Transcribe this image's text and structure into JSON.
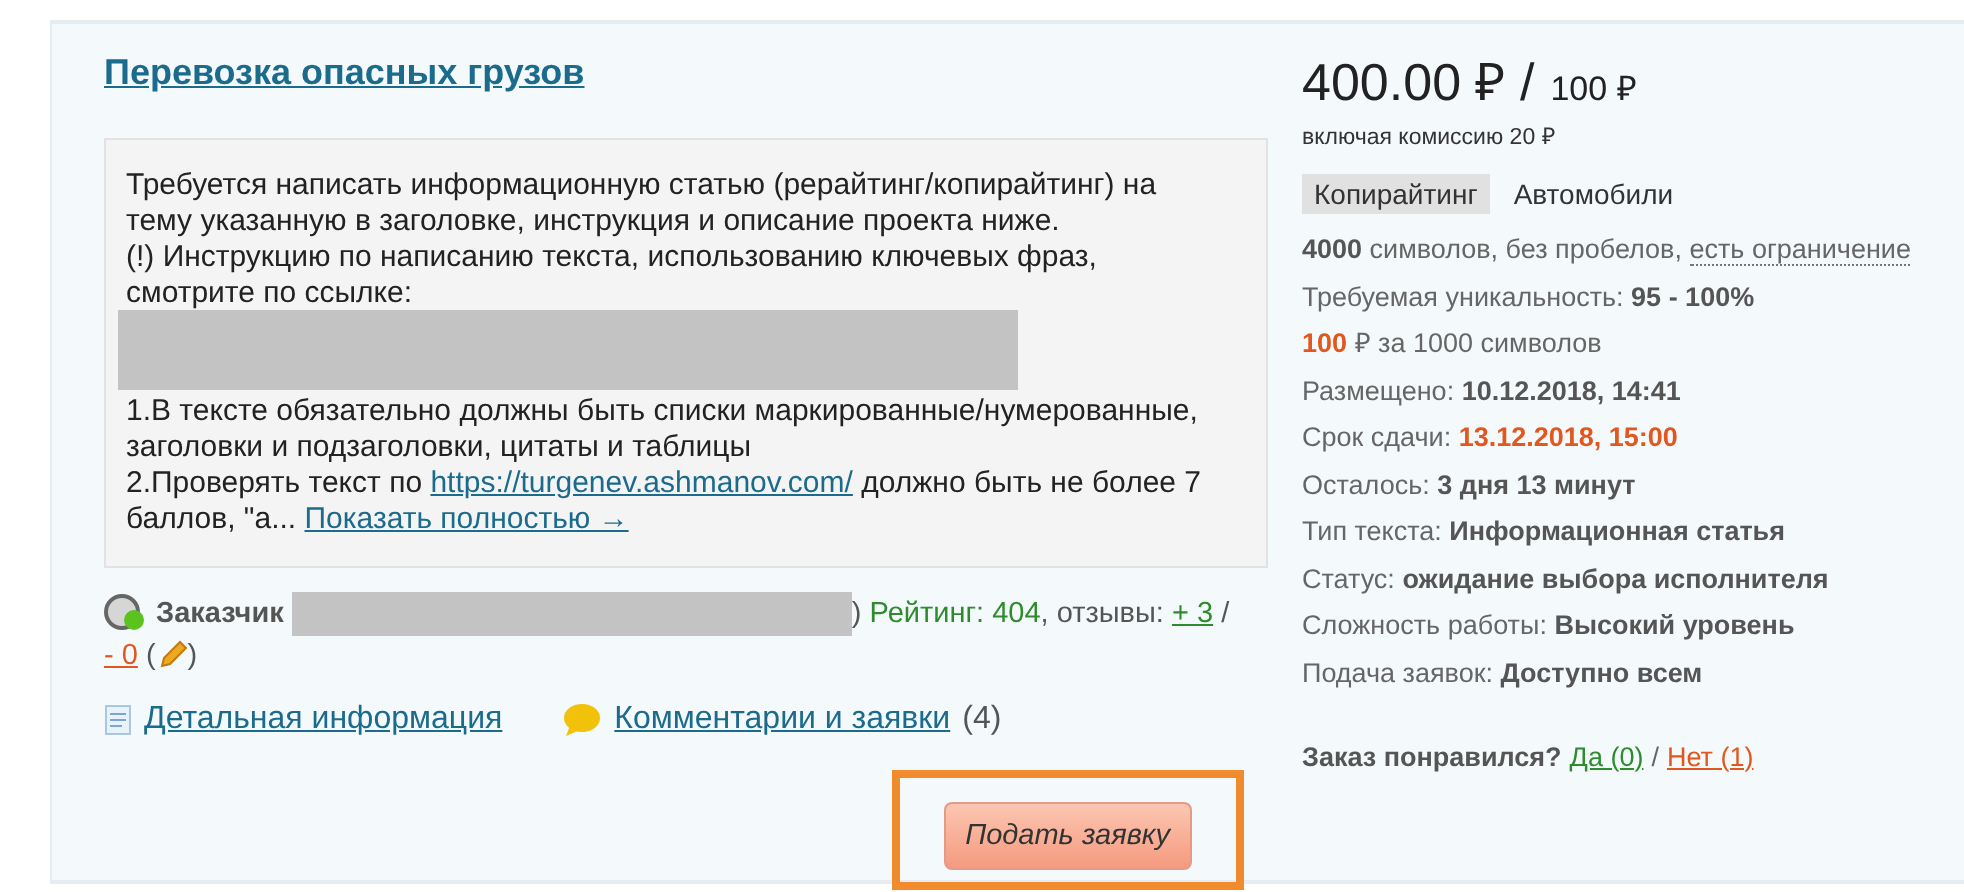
{
  "order": {
    "title": "Перевозка опасных грузов",
    "description": {
      "intro": [
        "Требуется написать информационную статью (рерайтинг/копирайтинг) на тему указанную в заголовке, инструкция и описание проекта ниже.",
        "(!) Инструкцию по написанию текста, использованию ключевых фраз, смотрите по ссылке:"
      ],
      "rules": "1.В тексте обязательно должны быть списки маркированные/нумерованные, заголовки и подзаголовки, цитаты и таблицы",
      "check_before": "2.Проверять текст по ",
      "check_link": "https://turgenev.ashmanov.com/",
      "check_after": " должно быть не более 7 баллов, \"а... ",
      "more_link": "Показать полностью →"
    },
    "customer": {
      "label": "Заказчик",
      "paren": ")",
      "rating": "Рейтинг: 404",
      "reviews_label": ", отзывы: ",
      "positive": "+ 3",
      "slash": "/",
      "negative": "- 0",
      "open": "(",
      "close": ")"
    },
    "links": [
      {
        "kind": "details",
        "label": "Детальная информация"
      },
      {
        "kind": "comments",
        "label": "Комментарии и заявки",
        "count": "(4)"
      }
    ],
    "apply_button": "Подать заявку"
  },
  "price": {
    "amount": "400.00 ₽ /",
    "per": "100 ₽",
    "commission": "включая комиссию 20 ₽"
  },
  "tags": [
    {
      "label": "Копирайтинг",
      "selected": true
    },
    {
      "label": "Автомобили",
      "selected": false
    }
  ],
  "details": [
    {
      "parts": [
        {
          "text": "4000",
          "kind": "bold"
        },
        {
          "text": " символов, без пробелов, ",
          "kind": "plain"
        },
        {
          "text": "есть ограничение",
          "kind": "hint"
        }
      ]
    },
    {
      "parts": [
        {
          "text": "Требуемая уникальность: ",
          "kind": "plain"
        },
        {
          "text": "95 - 100%",
          "kind": "bold"
        }
      ]
    },
    {
      "parts": [
        {
          "text": "100",
          "kind": "accent"
        },
        {
          "text": " ₽ за 1000 символов",
          "kind": "plain"
        }
      ]
    },
    {
      "parts": [
        {
          "text": "Размещено: ",
          "kind": "plain"
        },
        {
          "text": "10.12.2018, 14:41",
          "kind": "bold"
        }
      ]
    },
    {
      "parts": [
        {
          "text": "Срок сдачи: ",
          "kind": "plain"
        },
        {
          "text": "13.12.2018, 15:00",
          "kind": "accent"
        }
      ]
    },
    {
      "parts": [
        {
          "text": "Осталось: ",
          "kind": "plain"
        },
        {
          "text": "3 дня 13 минут",
          "kind": "bold"
        }
      ]
    },
    {
      "parts": [
        {
          "text": "Тип текста: ",
          "kind": "plain"
        },
        {
          "text": "Информационная статья",
          "kind": "bold"
        }
      ]
    },
    {
      "parts": [
        {
          "text": "Статус: ",
          "kind": "plain"
        },
        {
          "text": "ожидание выбора исполнителя",
          "kind": "bold"
        }
      ]
    },
    {
      "parts": [
        {
          "text": "Сложность работы: ",
          "kind": "plain"
        },
        {
          "text": "Высокий уровень",
          "kind": "bold"
        }
      ]
    },
    {
      "parts": [
        {
          "text": "Подача заявок: ",
          "kind": "plain"
        },
        {
          "text": "Доступно всем",
          "kind": "bold"
        }
      ]
    }
  ],
  "feedback": {
    "question": "Заказ понравился?",
    "yes": "Да (0)",
    "separator": "/",
    "no": "Нет (1)"
  }
}
